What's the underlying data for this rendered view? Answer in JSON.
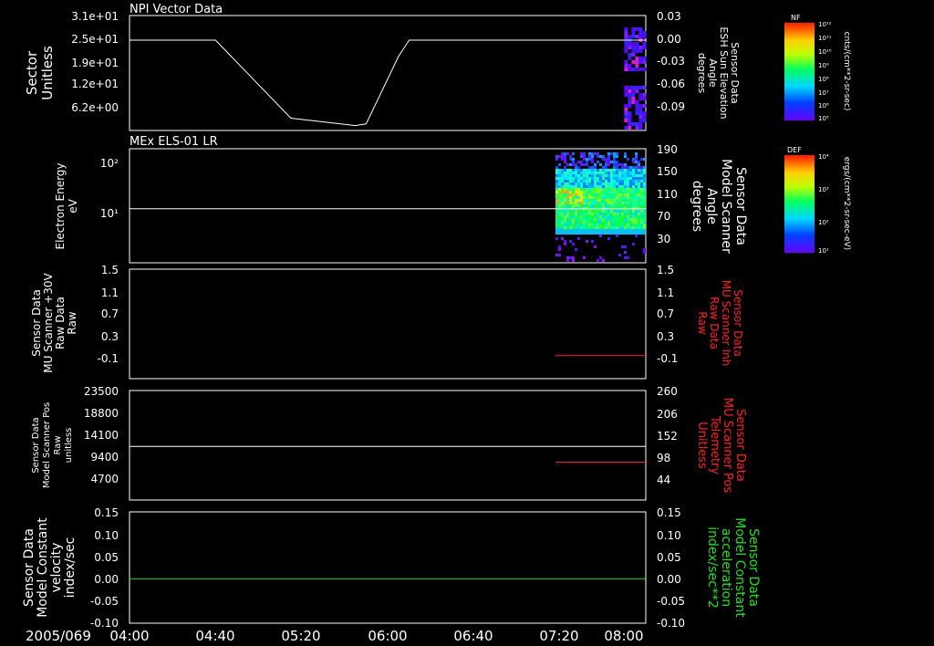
{
  "figure": {
    "date_label": "2005/069",
    "x_tick_labels": [
      "04:00",
      "04:40",
      "05:20",
      "06:00",
      "06:40",
      "07:20",
      "08:00"
    ]
  },
  "colors": {
    "background": "#000000",
    "axes": "#ffffff",
    "left_label": "#ffffff",
    "red_series": "#ff2020",
    "green_series": "#20e020"
  },
  "chart_data": [
    {
      "type": "heatmap",
      "title": "NPI Vector Data",
      "ylabel_lines": [
        "Sector",
        "Unitless"
      ],
      "y_tick_labels": [
        "3.1e+01",
        "2.5e+01",
        "1.9e+01",
        "1.2e+01",
        "6.2e+00"
      ],
      "right_tick_labels": [
        "0.03",
        "0.00",
        "-0.03",
        "-0.06",
        "-0.09"
      ],
      "right_label_lines": [
        "Sensor Data",
        "ESH Sun Elevation",
        "Angle",
        "degrees"
      ],
      "right_label_color": "white",
      "ylim": [
        0,
        31
      ],
      "right_ylim": [
        -0.11,
        0.03
      ],
      "colorbar": {
        "title": "NF",
        "ticks": [
          "10¹²",
          "10¹¹",
          "10¹⁰",
          "10⁹",
          "10⁸",
          "10⁷",
          "10⁶",
          "10⁵"
        ],
        "units": "cnts/(cm**2-sr-sec)"
      },
      "series": [
        {
          "type": "line",
          "axis": "right",
          "x": [
            "04:00",
            "04:40",
            "05:15",
            "05:45",
            "05:50",
            "06:05",
            "06:10",
            "08:00"
          ],
          "y": [
            0.0,
            0.0,
            -0.095,
            -0.104,
            -0.102,
            -0.02,
            0.0,
            0.0
          ]
        }
      ],
      "spectrogram": {
        "x_start": "07:50",
        "x_end": "08:00"
      }
    },
    {
      "type": "heatmap",
      "title": "MEx ELS-01 LR",
      "ylabel_lines": [
        "Electron Energy",
        "eV"
      ],
      "y_tick_labels": [
        "10²",
        "10¹"
      ],
      "right_tick_labels": [
        "190",
        "150",
        "110",
        "70",
        "30"
      ],
      "right_label_lines": [
        "Sensor Data",
        "Model Scanner",
        "Angle",
        "degrees"
      ],
      "right_label_color": "white",
      "ylim": [
        1,
        190
      ],
      "right_ylim": [
        0,
        190
      ],
      "colorbar": {
        "title": "DEF",
        "ticks": [
          "10⁴",
          "10³",
          "10²",
          "10¹"
        ],
        "units": "ergs/(cm**2-sr-sec-eV)"
      },
      "series": [
        {
          "type": "line",
          "axis": "right",
          "x": [
            "04:00",
            "08:00"
          ],
          "y": [
            90,
            90
          ]
        }
      ],
      "spectrogram": {
        "x_start": "07:18",
        "x_end": "07:59"
      }
    },
    {
      "type": "line",
      "ylabel_lines": [
        "Sensor Data",
        "MU Scanner +30V",
        "Raw Data",
        "Raw"
      ],
      "y_tick_labels": [
        "1.5",
        "1.1",
        "0.7",
        "0.3",
        "-0.1"
      ],
      "right_tick_labels": [
        "1.5",
        "1.1",
        "0.7",
        "0.3",
        "-0.1"
      ],
      "right_label_lines": [
        "Sensor Data",
        "MU Scanner Inh",
        "Raw Data",
        "Raw"
      ],
      "right_label_color": "red",
      "ylim": [
        -0.4,
        1.5
      ],
      "series": [
        {
          "axis": "right",
          "color": "red",
          "x": [
            "07:18",
            "08:00"
          ],
          "y": [
            0.0,
            0.0
          ]
        }
      ]
    },
    {
      "type": "line",
      "ylabel_lines": [
        "Sensor Data",
        "Model Scanner Pos",
        "Raw",
        "unitless"
      ],
      "y_tick_labels": [
        "23500",
        "18800",
        "14100",
        "9400",
        "4700"
      ],
      "right_tick_labels": [
        "260",
        "206",
        "152",
        "98",
        "44"
      ],
      "right_label_lines": [
        "Sensor Data",
        "MU Scanner Pos",
        "Telemetry",
        "Unitless"
      ],
      "right_label_color": "red",
      "ylim": [
        0,
        23500
      ],
      "right_ylim": [
        0,
        260
      ],
      "series": [
        {
          "axis": "left",
          "color": "white",
          "x": [
            "04:00",
            "08:00"
          ],
          "y": [
            11500,
            11500
          ]
        },
        {
          "axis": "right",
          "color": "red",
          "x": [
            "07:18",
            "08:00"
          ],
          "y": [
            90,
            90
          ]
        }
      ]
    },
    {
      "type": "line",
      "ylabel_lines": [
        "Sensor Data",
        "Model Constant",
        "velocity",
        "index/sec"
      ],
      "y_tick_labels": [
        "0.15",
        "0.10",
        "0.05",
        "0.00",
        "-0.05",
        "-0.10"
      ],
      "right_tick_labels": [
        "0.15",
        "0.10",
        "0.05",
        "0.00",
        "-0.05",
        "-0.10"
      ],
      "right_label_lines": [
        "Sensor Data",
        "Model Constant",
        "acceleration",
        "index/sec**2"
      ],
      "right_label_color": "green",
      "ylim": [
        -0.1,
        0.15
      ],
      "series": [
        {
          "axis": "left",
          "color": "green",
          "x": [
            "04:00",
            "08:00"
          ],
          "y": [
            0.0,
            0.0
          ]
        }
      ]
    }
  ]
}
